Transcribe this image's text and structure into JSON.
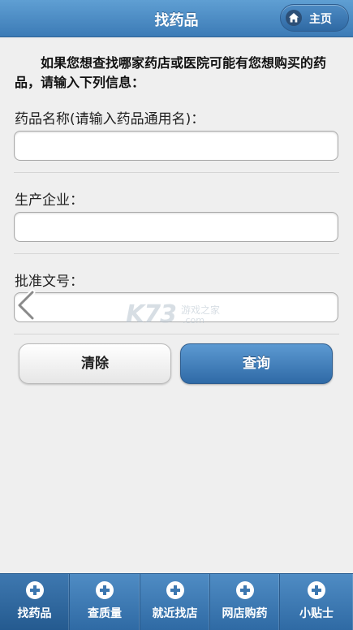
{
  "header": {
    "title": "找药品",
    "home_label": "主页"
  },
  "form": {
    "intro": "如果您想查找哪家药店或医院可能有您想购买的药品，请输入下列信息：",
    "fields": [
      {
        "label": "药品名称(请输入药品通用名)：",
        "value": "",
        "placeholder": ""
      },
      {
        "label": "生产企业：",
        "value": "",
        "placeholder": ""
      },
      {
        "label": "批准文号：",
        "value": "",
        "placeholder": ""
      }
    ],
    "clear_label": "清除",
    "query_label": "查询"
  },
  "watermark": {
    "logo": "K73",
    "zh": "游戏之家",
    "com": ".com"
  },
  "tabbar": {
    "items": [
      {
        "label": "找药品",
        "icon": "plus-circle-icon",
        "active": true
      },
      {
        "label": "查质量",
        "icon": "plus-circle-icon",
        "active": false
      },
      {
        "label": "就近找店",
        "icon": "plus-circle-icon",
        "active": false
      },
      {
        "label": "网店购药",
        "icon": "plus-circle-icon",
        "active": false
      },
      {
        "label": "小贴士",
        "icon": "plus-circle-icon",
        "active": false
      }
    ]
  },
  "colors": {
    "header_blue": "#3c7bb6",
    "tab_blue": "#2f6aa4",
    "background": "#efefef"
  }
}
